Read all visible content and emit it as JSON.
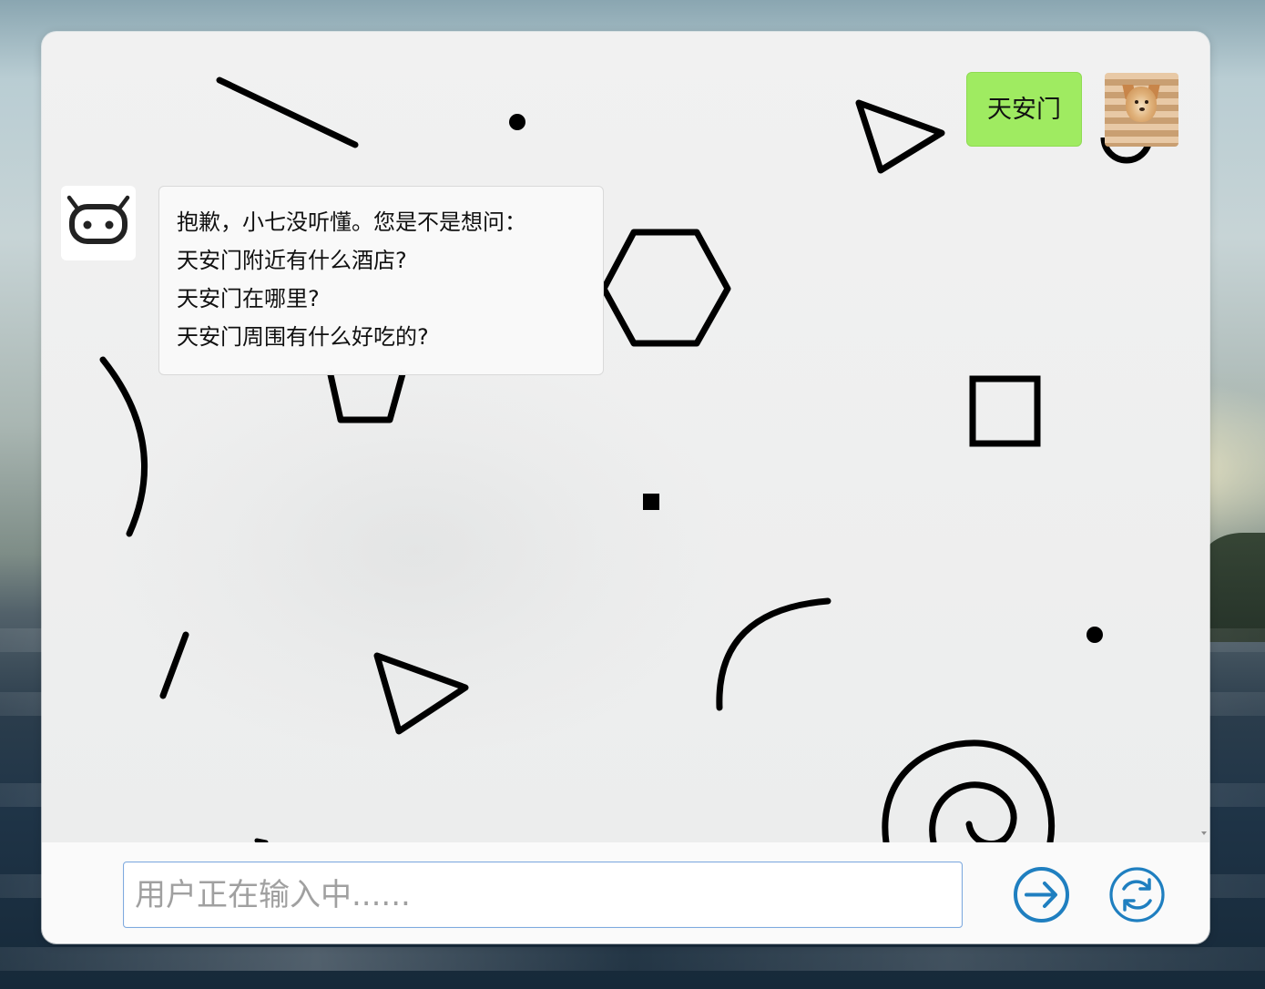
{
  "conversation": {
    "user_message": "天安门",
    "bot_lines": [
      "抱歉，小七没听懂。您是不是想问：",
      "天安门附近有什么酒店?",
      "天安门在哪里?",
      "天安门周围有什么好吃的?"
    ]
  },
  "composer": {
    "placeholder": "用户正在输入中......",
    "value": ""
  },
  "icons": {
    "bot_avatar": "robot-face-icon",
    "user_avatar": "dog-avatar",
    "send": "arrow-right-circle-icon",
    "refresh": "refresh-circle-icon"
  },
  "colors": {
    "user_bubble": "#9feb61",
    "bot_bubble": "#f9f9f9",
    "accent_blue": "#1f7fc0",
    "input_border": "#7eaadf"
  }
}
